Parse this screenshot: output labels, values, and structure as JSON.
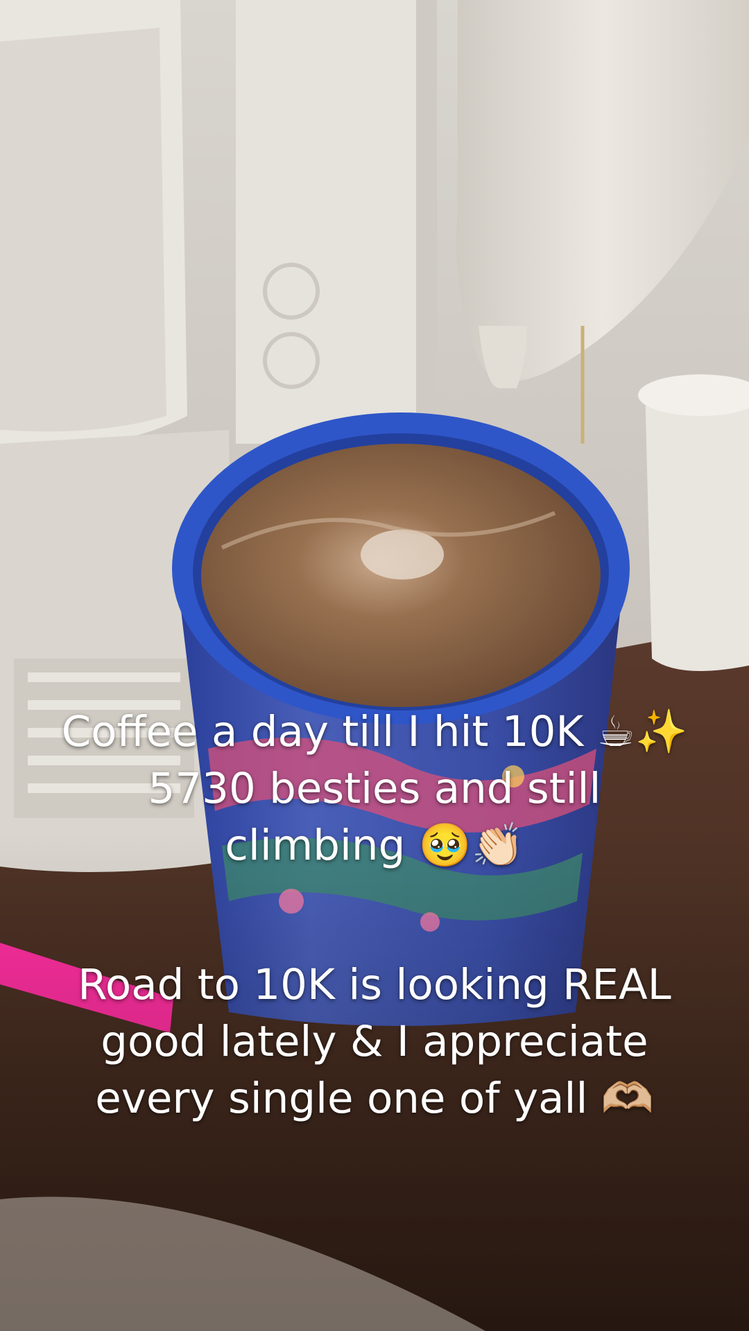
{
  "caption_block_1": {
    "line_1": "Coffee a day till I hit 10K ☕✨",
    "line_2": "5730  besties and still",
    "line_3": "climbing 🥹👏🏻"
  },
  "caption_block_2": {
    "line_1": "Road to 10K is looking REAL",
    "line_2": "good lately & I appreciate",
    "line_3": "every single one of yall 🫶🏼"
  },
  "colors": {
    "cup_rim": "#2f56c8",
    "coffee": "#8a6448",
    "counter": "#4a3026",
    "machine": "#e4e0d9",
    "straw": "#ff2fa0"
  }
}
